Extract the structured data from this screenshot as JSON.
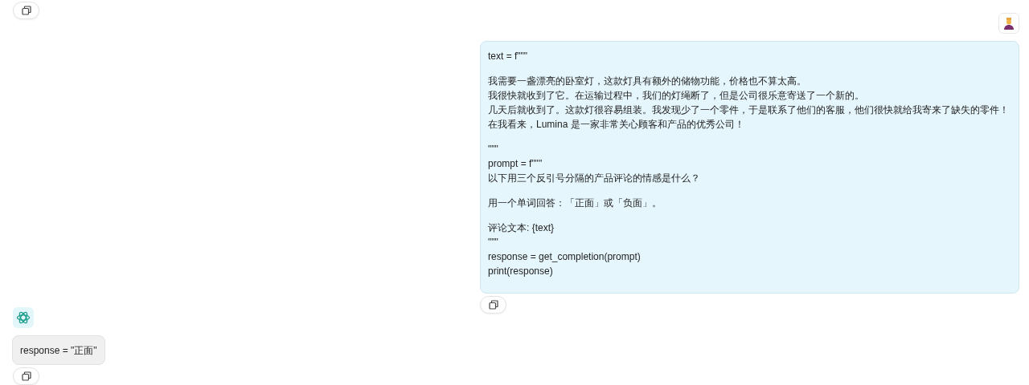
{
  "messages": [
    {
      "kind": "user",
      "paragraphs": [
        [
          "text = f\"\"\""
        ],
        [
          "我需要一盏漂亮的卧室灯，这款灯具有额外的储物功能，价格也不算太高。",
          "我很快就收到了它。在运输过程中，我们的灯绳断了，但是公司很乐意寄送了一个新的。",
          "几天后就收到了。这款灯很容易组装。我发现少了一个零件，于是联系了他们的客服，他们很快就给我寄来了缺失的零件！",
          "在我看来，Lumina 是一家非常关心顾客和产品的优秀公司！"
        ],
        [
          "\"\"\"",
          "prompt = f\"\"\"",
          "以下用三个反引号分隔的产品评论的情感是什么？"
        ],
        [
          "用一个单词回答：「正面」或「负面」。"
        ],
        [
          "评论文本: {text}",
          "\"\"\"",
          "response = get_completion(prompt)",
          "print(response)"
        ]
      ]
    },
    {
      "kind": "assistant",
      "paragraphs": [
        [
          "response = \"正面\""
        ]
      ]
    }
  ]
}
